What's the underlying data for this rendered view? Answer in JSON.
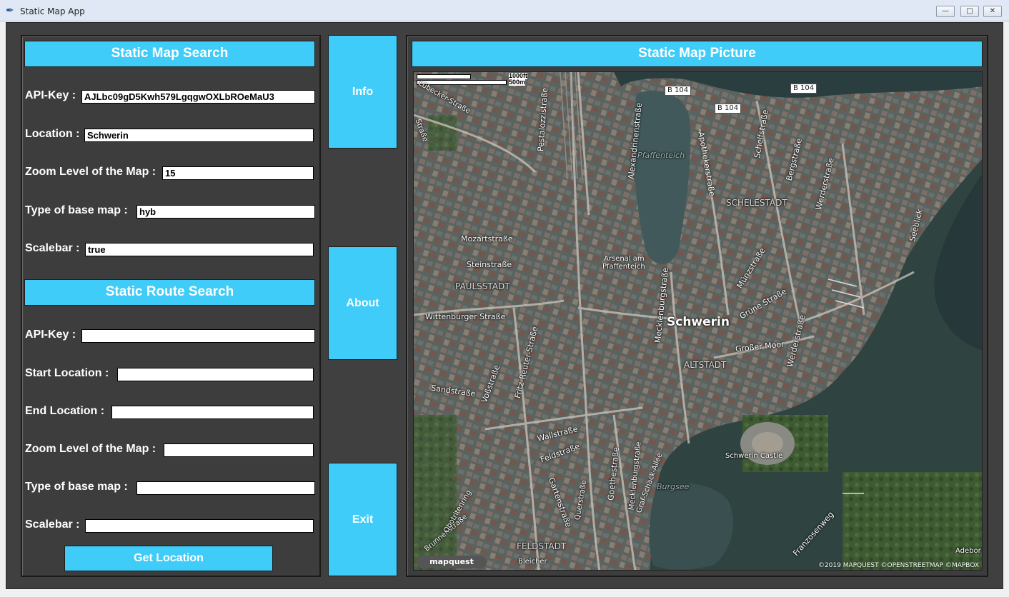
{
  "window": {
    "title": "Static Map App",
    "min_label": "—",
    "max_label": "□",
    "close_label": "✕"
  },
  "map_search": {
    "header": "Static Map Search",
    "fields": [
      {
        "label": "API-Key :",
        "value": "AJLbc09gD5Kwh579LgqgwOXLbROeMaU3"
      },
      {
        "label": "Location :",
        "value": "Schwerin"
      },
      {
        "label": "Zoom Level of the Map :",
        "value": "15"
      },
      {
        "label": "Type of base map :",
        "value": "hyb"
      },
      {
        "label": "Scalebar :",
        "value": "true"
      }
    ]
  },
  "route_search": {
    "header": "Static Route Search",
    "fields": [
      {
        "label": "API-Key :",
        "value": ""
      },
      {
        "label": "Start Location :",
        "value": ""
      },
      {
        "label": "End Location :",
        "value": ""
      },
      {
        "label": "Zoom Level of the Map :",
        "value": ""
      },
      {
        "label": "Type of base map :",
        "value": ""
      },
      {
        "label": "Scalebar :",
        "value": ""
      }
    ],
    "get_button": "Get Location"
  },
  "side_buttons": {
    "info": "Info",
    "about": "About",
    "exit": "Exit"
  },
  "map_picture": {
    "header": "Static Map Picture",
    "scale_ft": "1000ft",
    "scale_m": "500m",
    "attribution": "©2019 MAPQUEST ©OPENSTREETMAP ©MAPBOX",
    "logo": "mapquest",
    "road_signs": [
      "B 104",
      "B 104",
      "B 104"
    ],
    "labels": {
      "city": "Schwerin",
      "pfaffenteich": "Pfaffenteich",
      "schelestadt": "SCHELESTADT",
      "paulsstadt": "PAULSSTADT",
      "altstadt": "ALTSTADT",
      "feldstadt": "FELDSTADT",
      "castle": "Schwerin Castle",
      "arsenal_1": "Arsenal am",
      "arsenal_2": "Pfaffenteich",
      "burgsee": "Burgsee",
      "mozart": "Mozartstraße",
      "stein": "Steinstraße",
      "wittenburger": "Wittenburger Straße",
      "sand": "Sandstraße",
      "wall": "Wallstraße",
      "feld": "Feldstraße",
      "gross_moor": "Großer Moor",
      "gruene": "Grüne Straße",
      "muenz": "Münzstraße",
      "mecklenburg": "Mecklenburgstraße",
      "alexandrinen": "Alexandrinenstraße",
      "apotheker": "Apothekerstraße",
      "schelf": "Schelfstraße",
      "berg": "Bergstraße",
      "werder": "Werderstraße",
      "werder2": "Werderstraße",
      "seeblick": "Seeblick",
      "pestalozzi": "Pestalozzistraße",
      "fritz": "Fritz-Reuter-Straße",
      "voss": "Voßstraße",
      "goethe": "Goethestraße",
      "garten": "Gartenstraße",
      "franzosenweg": "Franzosenweg",
      "adebor": "Adebor",
      "bleicher": "Bleicher",
      "brunnen": "Brunnenstraße",
      "obotriten": "Obotritenring",
      "schack": "Graf-Schack-Allee",
      "quer": "Querstraße",
      "mecklenburg2": "Mecklenburgstraße",
      "strasse_left": "Straße",
      "lubecker": "Lübecker-Straße"
    }
  }
}
